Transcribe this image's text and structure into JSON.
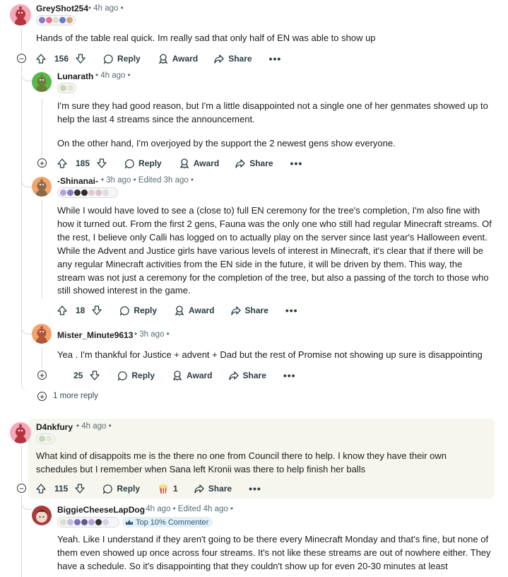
{
  "comments": [
    {
      "username": "GreyShot254",
      "meta": "• 4h ago •",
      "body": [
        "Hands of the table real quick. Im really sad that only half of EN was able to show up"
      ],
      "votes": "156",
      "actions": {
        "reply": "Reply",
        "award": "Award",
        "share": "Share",
        "more": "•••"
      }
    },
    {
      "username": "Lunarath",
      "meta": "• 4h ago •",
      "body": [
        "I'm sure they had good reason, but I'm a little disappointed not a single one of her genmates showed up to help the last 4 streams since the announcement.",
        "On the other hand, I'm overjoyed by the support the 2 newest gens show everyone."
      ],
      "votes": "185",
      "actions": {
        "reply": "Reply",
        "award": "Award",
        "share": "Share",
        "more": "•••"
      }
    },
    {
      "username": "-Shinanai-",
      "meta": "• 3h ago • Edited 3h ago •",
      "body": [
        "While I would have loved to see a (close to) full EN ceremony for the tree's completion, I'm also fine with how it turned out. From the first 2 gens, Fauna was the only one who still had regular Minecraft streams. Of the rest, I believe only Calli has logged on to actually play on the server since last year's Halloween event. While the Advent and Justice girls have various levels of interest in Minecraft, it's clear that if there will be any regular Minecraft activities from the EN side in the future, it will be driven by them. This way, the stream was not just a ceremony for the completion of the tree, but also a passing of the torch to those who still showed interest in the game."
      ],
      "votes": "18",
      "actions": {
        "reply": "Reply",
        "award": "Award",
        "share": "Share",
        "more": "•••"
      }
    },
    {
      "username": "Mister_Minute9613",
      "meta": "• 3h ago •",
      "body": [
        "Yea . I'm thankful for Justice + advent + Dad but the rest of Promise not showing up sure is disappointing"
      ],
      "votes": "25",
      "actions": {
        "reply": "Reply",
        "award": "Award",
        "share": "Share",
        "more": "•••"
      }
    },
    {
      "username": "D4nkfury",
      "meta": "• 4h ago •",
      "body": [
        "What kind of disappoits me is the there no one from Council there to help. I know they have their own schedules but I remember when Sana left Kronii was there to help finish her balls"
      ],
      "votes": "115",
      "award_count": "1",
      "actions": {
        "reply": "Reply",
        "award": "Award",
        "share": "Share",
        "more": "•••"
      }
    },
    {
      "username": "BiggieCheeseLapDog",
      "meta": "• 4h ago • Edited 4h ago •",
      "badge": "Top 10% Commenter",
      "body": [
        "Yeah. Like I understand if they aren't going to be there every Minecraft Monday and that's fine, but none of them even showed up once across four streams. It's not like these streams are out of nowhere either. They have a schedule. So it's disappointing that they couldn't show up for even 20-30 minutes at least"
      ]
    }
  ],
  "more_replies": "1 more reply",
  "colors": {
    "accent_bg": "#f6f6ef",
    "avatar_pink": "#f4a8b8",
    "avatar_green": "#58b84a",
    "avatar_orange": "#f2a36a",
    "thread_line": "#d5dadd",
    "badge_bg": "#e3f0f8"
  }
}
